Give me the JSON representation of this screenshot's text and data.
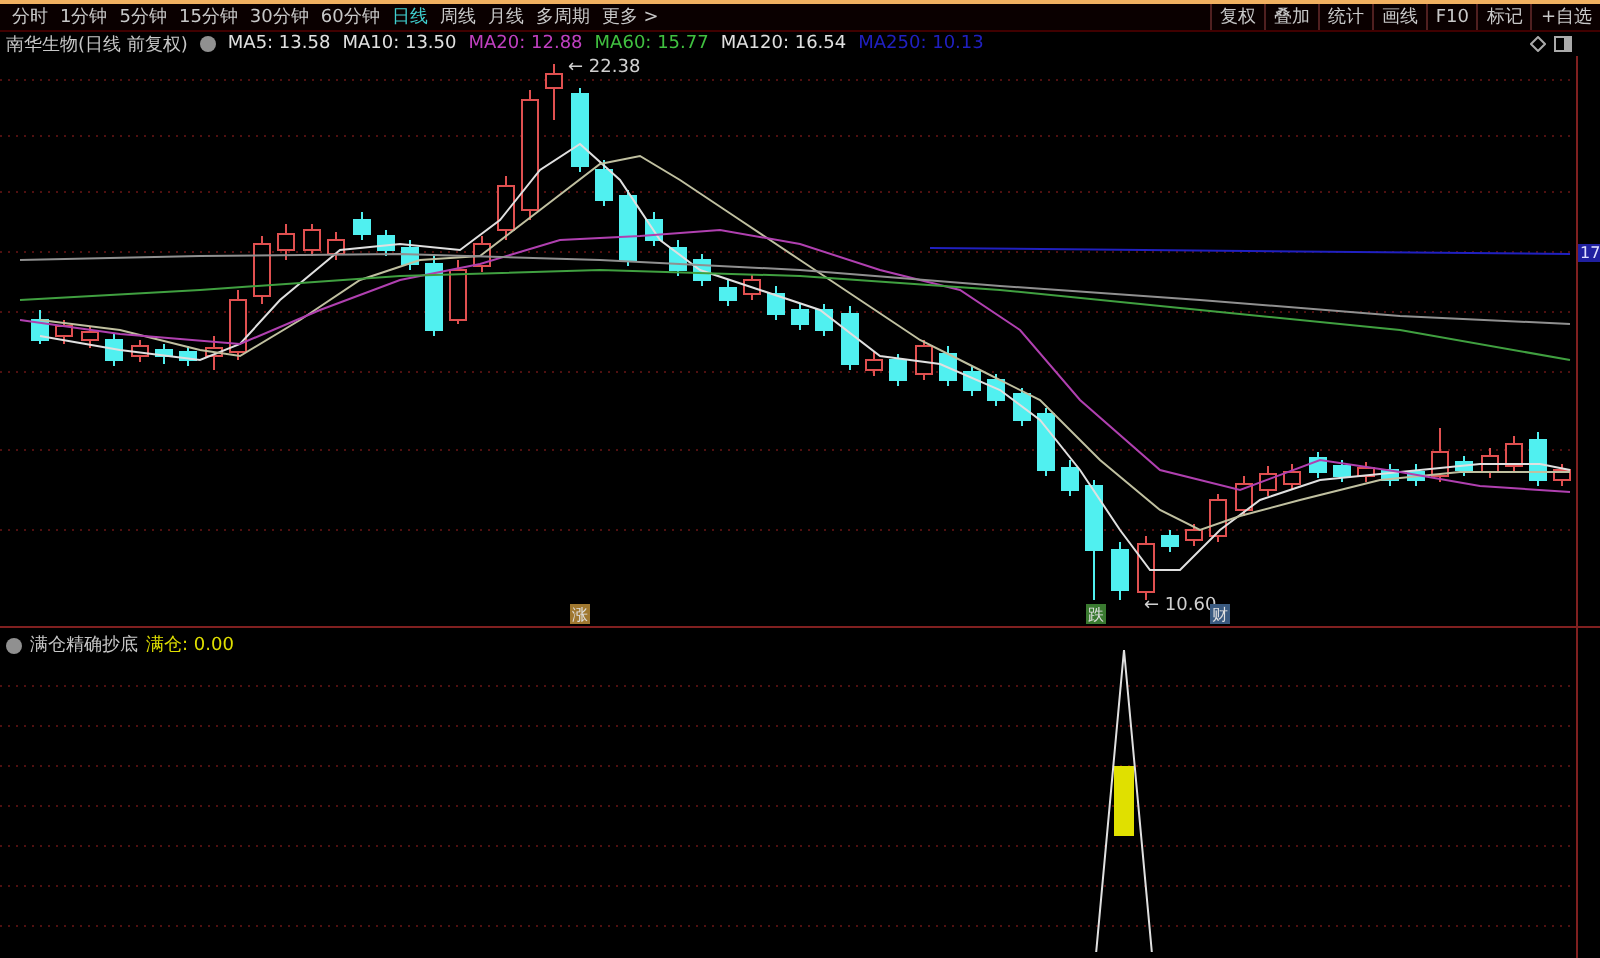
{
  "toolbar": {
    "periods": [
      {
        "label": "分时",
        "selected": false
      },
      {
        "label": "1分钟",
        "selected": false
      },
      {
        "label": "5分钟",
        "selected": false
      },
      {
        "label": "15分钟",
        "selected": false
      },
      {
        "label": "30分钟",
        "selected": false
      },
      {
        "label": "60分钟",
        "selected": false
      },
      {
        "label": "日线",
        "selected": true
      },
      {
        "label": "周线",
        "selected": false
      },
      {
        "label": "月线",
        "selected": false
      },
      {
        "label": "多周期",
        "selected": false
      },
      {
        "label": "更多 >",
        "selected": false
      }
    ],
    "actions": [
      "复权",
      "叠加",
      "统计",
      "画线",
      "F10",
      "标记",
      "+自选"
    ]
  },
  "legend": {
    "title": "南华生物(日线 前复权)",
    "indicators": [
      {
        "label": "MA5: 13.58",
        "color": "#e0e0e0"
      },
      {
        "label": "MA10: 13.50",
        "color": "#e0e0e0"
      },
      {
        "label": "MA20: 12.88",
        "color": "#c040c0"
      },
      {
        "label": "MA60: 15.77",
        "color": "#40c040"
      },
      {
        "label": "MA120: 16.54",
        "color": "#e0e0e0"
      },
      {
        "label": "MA250: 10.13",
        "color": "#2020c0"
      }
    ]
  },
  "main_chart": {
    "high_label": "← 22.38",
    "low_label": "← 10.60",
    "axis_tag": "17",
    "events": [
      {
        "label": "涨",
        "color": "#a07830"
      },
      {
        "label": "跌",
        "color": "#3a7a30"
      },
      {
        "label": "财",
        "color": "#3a5a80"
      }
    ]
  },
  "sub_chart": {
    "title": "满仓精确抄底",
    "readings": [
      {
        "label": "满仓: 0.00",
        "color": "#e0e000"
      }
    ]
  }
}
